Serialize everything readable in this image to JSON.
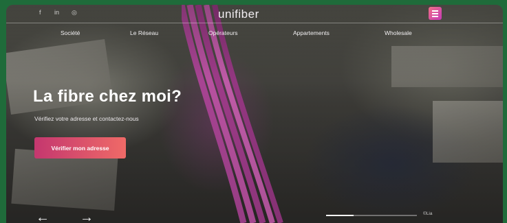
{
  "header": {
    "brand": "unifiber",
    "social": [
      {
        "name": "facebook-icon",
        "glyph": "f"
      },
      {
        "name": "linkedin-icon",
        "glyph": "in"
      },
      {
        "name": "instagram-icon",
        "glyph": "◎"
      }
    ],
    "menu_color": "#e1497f"
  },
  "nav": {
    "items": [
      "Société",
      "Le Réseau",
      "Opérateurs",
      "Appartements",
      "Wholesale"
    ]
  },
  "hero": {
    "title": "La fibre chez moi?",
    "subtitle": "Vérifiez votre adresse et contactez-nous",
    "cta_label": "Vérifier mon adresse",
    "cta_gradient": [
      "#c4376f",
      "#ef6a67"
    ]
  },
  "slider": {
    "prev_glyph": "←",
    "next_glyph": "→",
    "progress": 0.3,
    "credit": "©Lia"
  }
}
